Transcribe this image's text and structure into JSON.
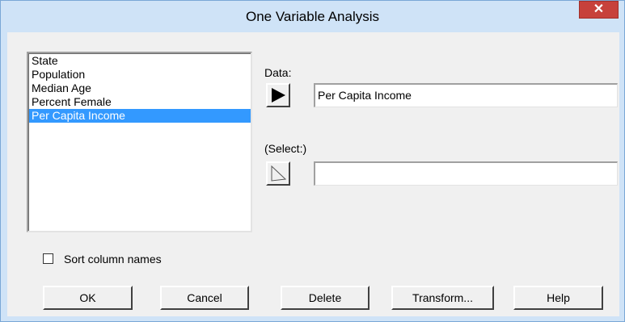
{
  "window": {
    "title": "One Variable Analysis",
    "close_glyph": "✕"
  },
  "variables": {
    "items": [
      "State",
      "Population",
      "Median Age",
      "Percent Female",
      "Per Capita Income"
    ],
    "selected": "Per Capita Income"
  },
  "data_field": {
    "label": "Data:",
    "value": "Per Capita Income"
  },
  "select_field": {
    "label": "(Select:)",
    "value": ""
  },
  "sort_option": {
    "label": "Sort column names",
    "checked": false
  },
  "buttons": {
    "ok": "OK",
    "cancel": "Cancel",
    "delete": "Delete",
    "transform": "Transform...",
    "help": "Help"
  },
  "colors": {
    "titlebar": "#cfe3f7",
    "close_button": "#c7413b",
    "selection": "#3399ff",
    "dialog_bg": "#f0f0f0"
  }
}
